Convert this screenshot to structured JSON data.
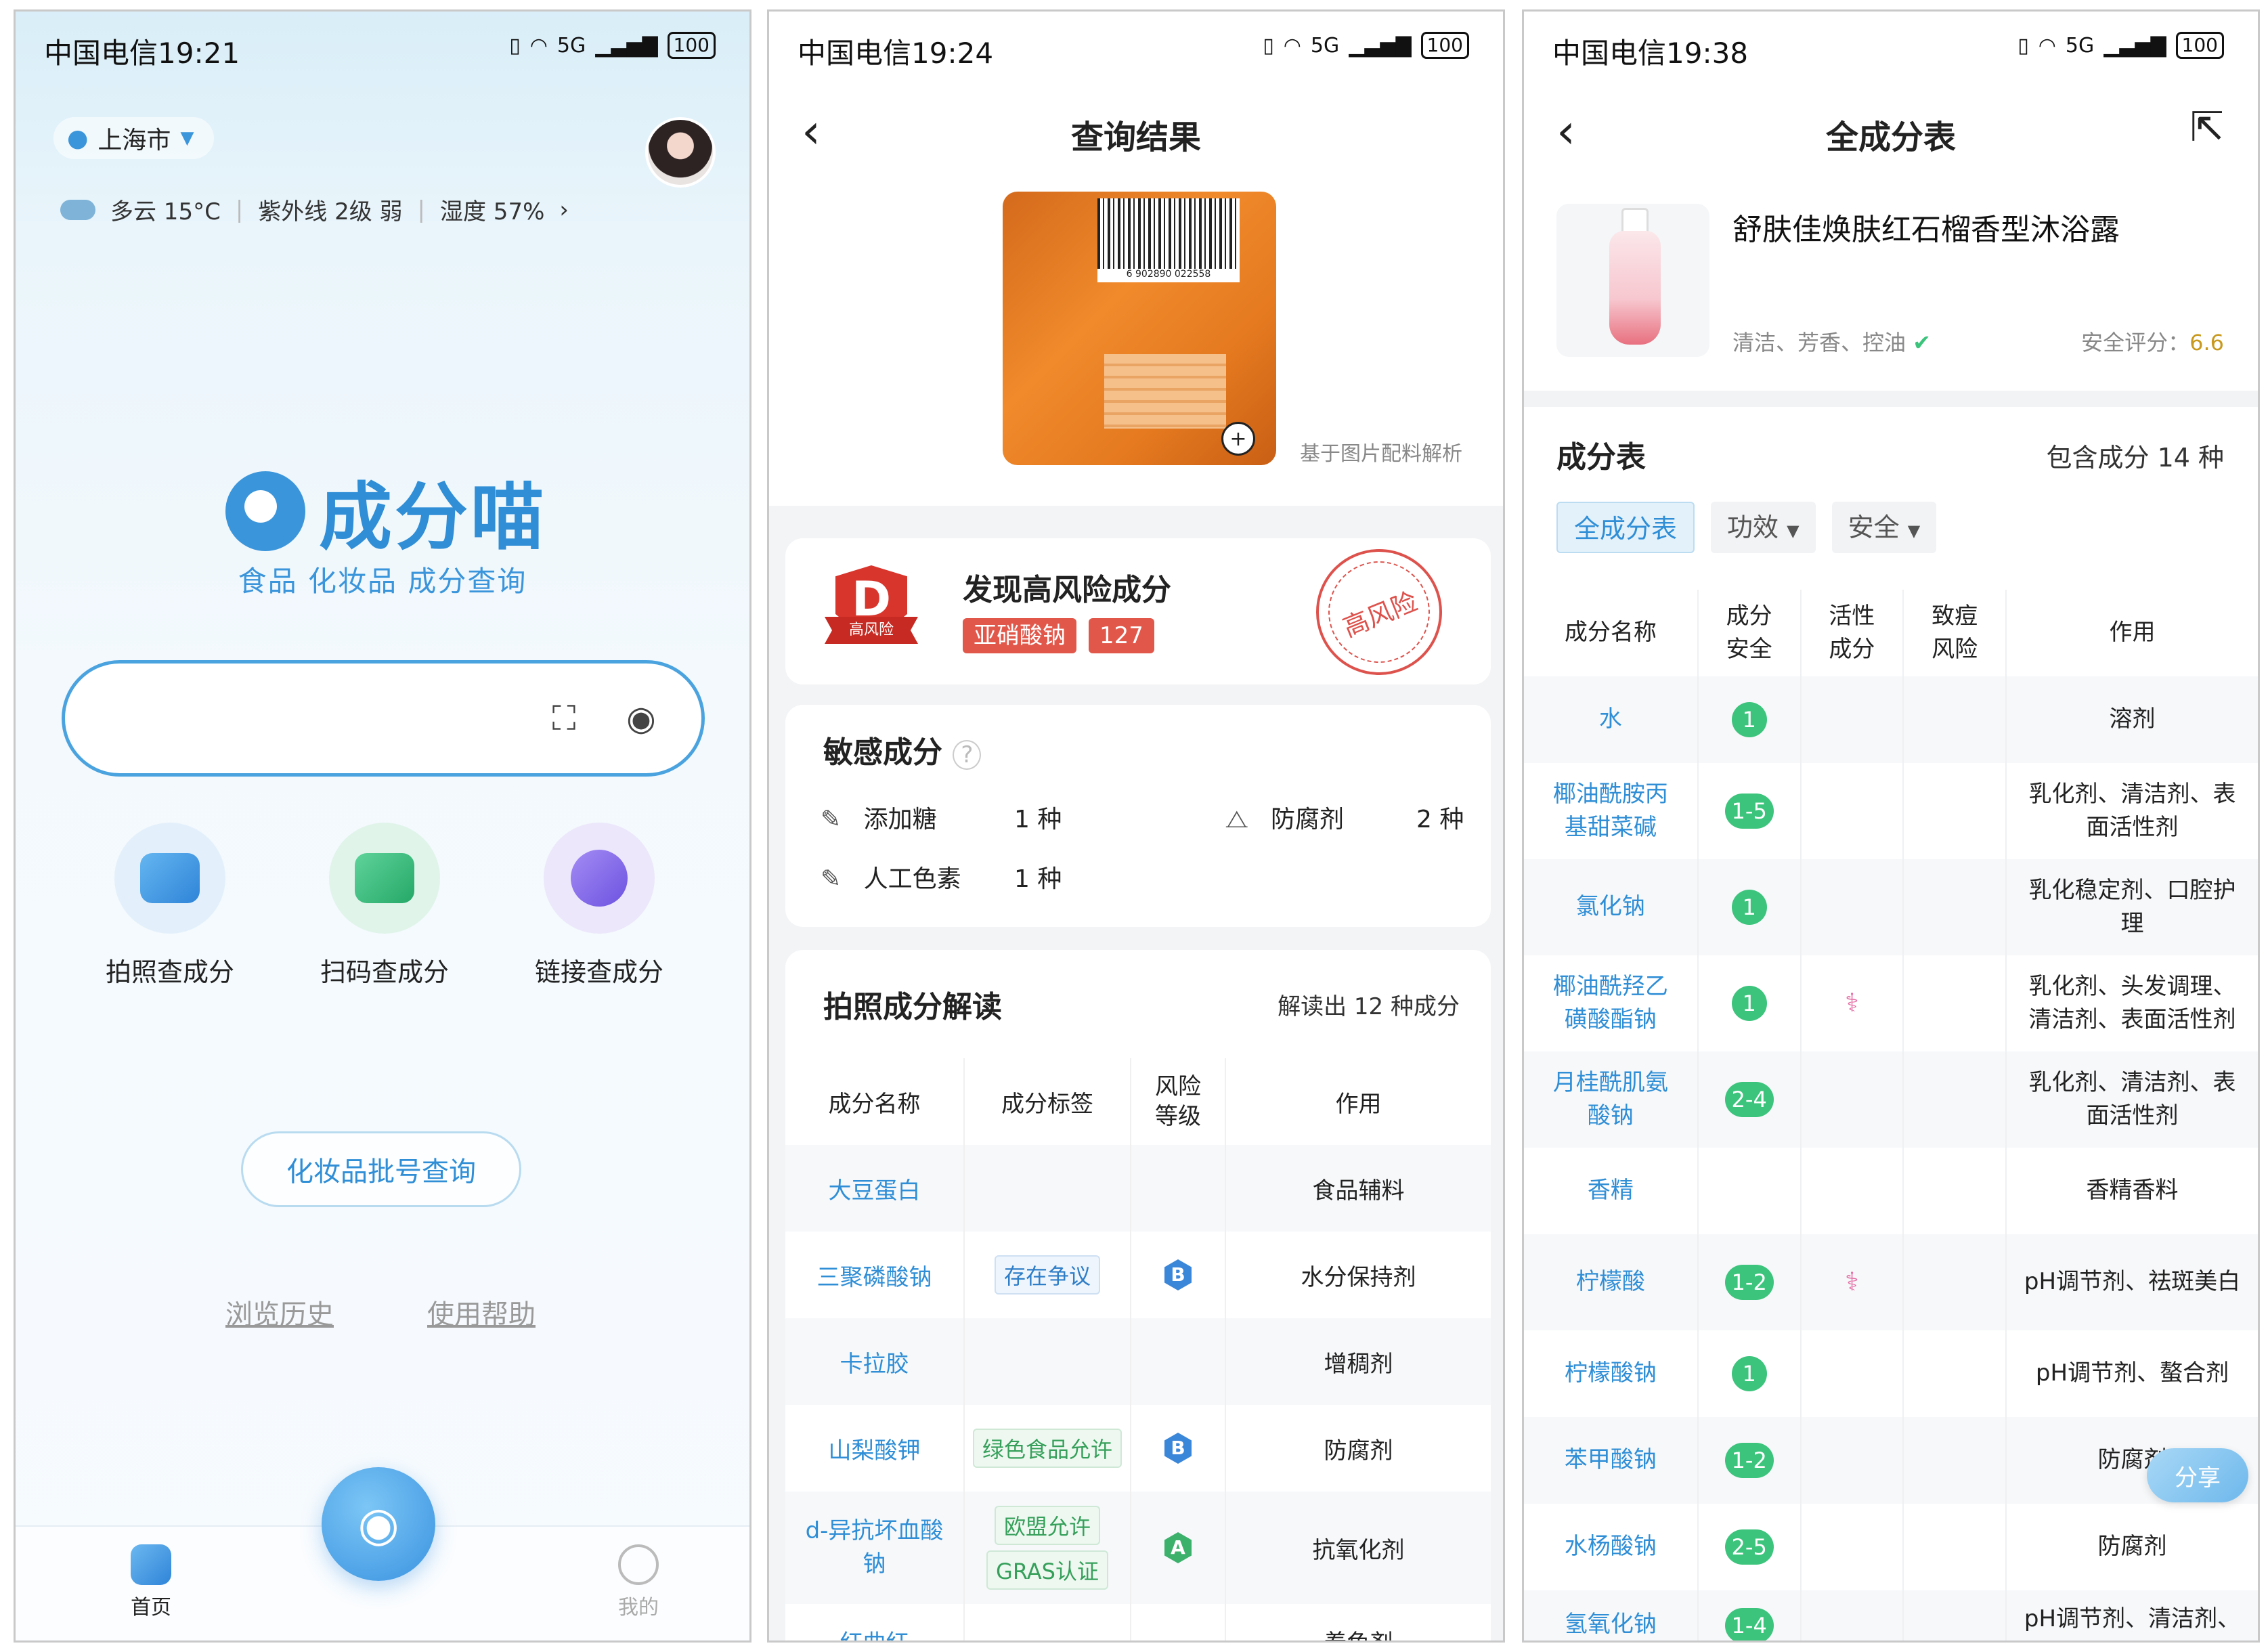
{
  "status": {
    "carrier_time_1": "中国电信19:21",
    "carrier_time_2": "中国电信19:24",
    "carrier_time_3": "中国电信19:38",
    "network": "5G",
    "battery": "100"
  },
  "home": {
    "city": "上海市",
    "weather": "多云 15°C",
    "uv": "紫外线 2级 弱",
    "humidity": "湿度 57%",
    "app_name": "成分喵",
    "slogan": "食品 化妆品 成分查询",
    "search_placeholder": "",
    "features": [
      "拍照查成分",
      "扫码查成分",
      "链接查成分"
    ],
    "batch_query": "化妆品批号查询",
    "history": "浏览历史",
    "help": "使用帮助",
    "tab_home": "首页",
    "tab_mine": "我的"
  },
  "result": {
    "title": "查询结果",
    "basis": "基于图片配料解析",
    "barcode_text": "6 902890 022558",
    "risk_grade": "D",
    "risk_label": "高风险",
    "risk_title": "发现高风险成分",
    "risk_ingredient": "亚硝酸钠",
    "risk_code": "127",
    "stamp_text": "高风险",
    "sensitive_title": "敏感成分",
    "sensitive": [
      {
        "name": "添加糖",
        "count": "1 种"
      },
      {
        "name": "防腐剂",
        "count": "2 种"
      },
      {
        "name": "人工色素",
        "count": "1 种"
      }
    ],
    "photo_title": "拍照成分解读",
    "photo_count": "解读出 12 种成分",
    "table_headers": [
      "成分名称",
      "成分标签",
      "风险等级",
      "作用"
    ],
    "rows": [
      {
        "name": "大豆蛋白",
        "tags": [],
        "grade": "",
        "use": "食品辅料"
      },
      {
        "name": "三聚磷酸钠",
        "tags": [
          "存在争议"
        ],
        "grade": "B",
        "use": "水分保持剂"
      },
      {
        "name": "卡拉胶",
        "tags": [],
        "grade": "",
        "use": "增稠剂"
      },
      {
        "name": "山梨酸钾",
        "tags": [
          "绿色食品允许"
        ],
        "grade": "B",
        "use": "防腐剂"
      },
      {
        "name": "d-异抗坏血酸钠",
        "tags": [
          "欧盟允许",
          "GRAS认证"
        ],
        "grade": "A",
        "use": "抗氧化剂"
      },
      {
        "name": "红曲红",
        "tags": [],
        "grade": "",
        "use": "着色剂"
      }
    ],
    "grade_colors": {
      "A": "#3cb16b",
      "B": "#3a86d8"
    }
  },
  "full": {
    "title": "全成分表",
    "product_name": "舒肤佳焕肤红石榴香型沐浴露",
    "product_tags": "清洁、芳香、控油",
    "score_label": "安全评分：",
    "score_value": "6.6",
    "section_title": "成分表",
    "section_count": "包含成分 14 种",
    "filters": [
      "全成分表",
      "功效",
      "安全"
    ],
    "headers": [
      "成分名称",
      "成分安全",
      "活性成分",
      "致痘风险",
      "作用"
    ],
    "rows": [
      {
        "name": "水",
        "safety": "1",
        "active": false,
        "use": "溶剂"
      },
      {
        "name": "椰油酰胺丙基甜菜碱",
        "safety": "1-5",
        "active": false,
        "use": "乳化剂、清洁剂、表面活性剂"
      },
      {
        "name": "氯化钠",
        "safety": "1",
        "active": false,
        "use": "乳化稳定剂、口腔护理"
      },
      {
        "name": "椰油酰羟乙磺酸酯钠",
        "safety": "1",
        "active": true,
        "use": "乳化剂、头发调理、清洁剂、表面活性剂"
      },
      {
        "name": "月桂酰肌氨酸钠",
        "safety": "2-4",
        "active": false,
        "use": "乳化剂、清洁剂、表面活性剂"
      },
      {
        "name": "香精",
        "safety": "",
        "active": false,
        "use": "香精香料"
      },
      {
        "name": "柠檬酸",
        "safety": "1-2",
        "active": true,
        "use": "pH调节剂、祛斑美白"
      },
      {
        "name": "柠檬酸钠",
        "safety": "1",
        "active": false,
        "use": "pH调节剂、螯合剂"
      },
      {
        "name": "苯甲酸钠",
        "safety": "1-2",
        "active": false,
        "use": "防腐剂"
      },
      {
        "name": "水杨酸钠",
        "safety": "2-5",
        "active": false,
        "use": "防腐剂"
      },
      {
        "name": "氢氧化钠",
        "safety": "1-4",
        "active": false,
        "use": "pH调节剂、清洁剂、"
      }
    ],
    "share": "分享"
  }
}
